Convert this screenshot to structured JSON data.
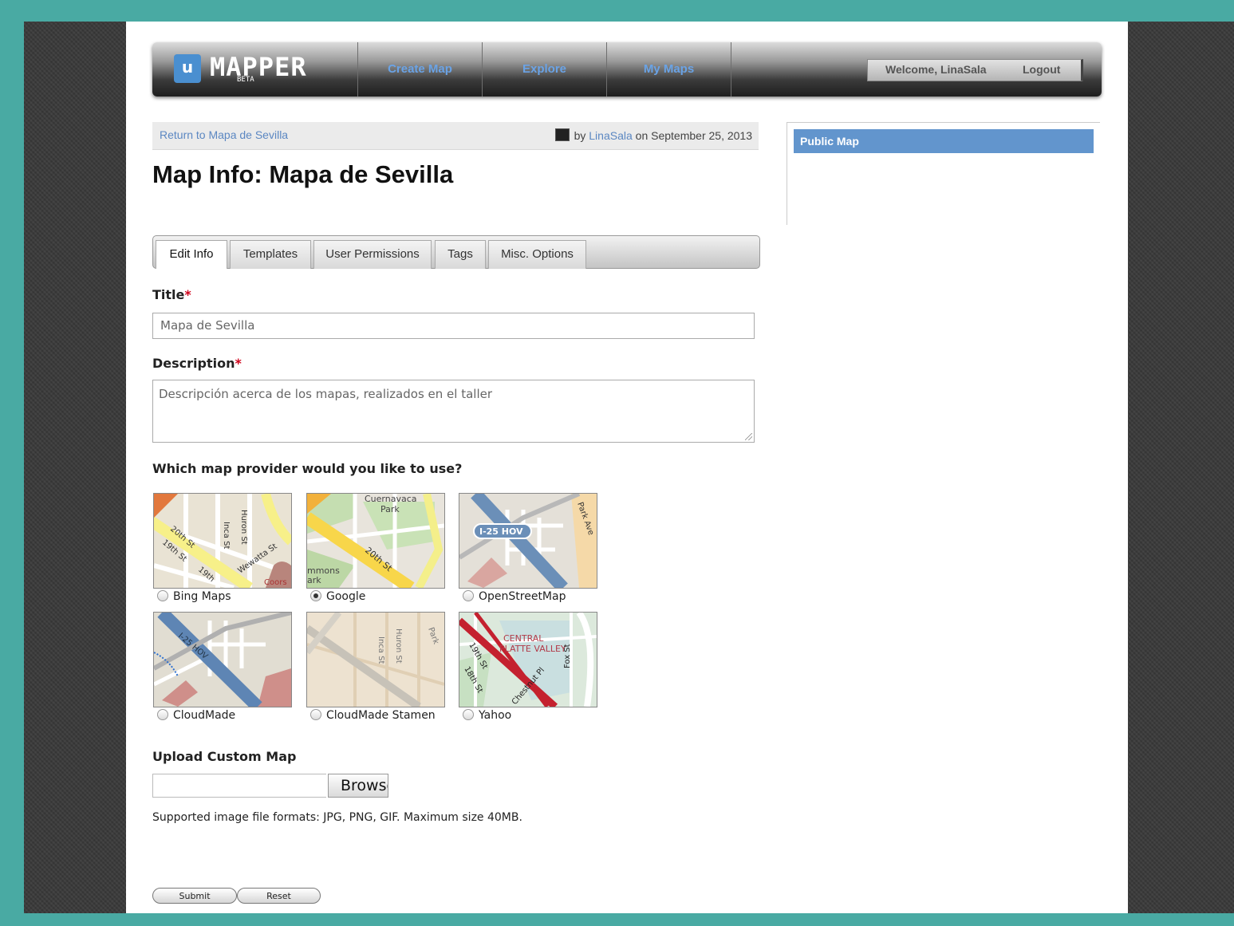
{
  "header": {
    "logo_letter": "u",
    "logo_name": "MAPPER",
    "logo_badge": "BETA",
    "nav": [
      "Create Map",
      "Explore",
      "My Maps"
    ],
    "welcome": "Welcome, LinaSala",
    "logout": "Logout"
  },
  "infobar": {
    "back_link": "Return to Mapa de Sevilla",
    "by": "by",
    "author": "LinaSala",
    "date": "on September 25, 2013"
  },
  "page_title": "Map Info: Mapa de Sevilla",
  "sidebar": {
    "heading": "Public Map"
  },
  "tabs": [
    {
      "label": "Edit Info"
    },
    {
      "label": "Templates"
    },
    {
      "label": "User Permissions"
    },
    {
      "label": "Tags"
    },
    {
      "label": "Misc. Options"
    }
  ],
  "form": {
    "title_label": "Title",
    "title_value": "Mapa de Sevilla",
    "description_label": "Description",
    "description_value": "Descripción acerca de los mapas, realizados en el taller",
    "required_marker": "*",
    "provider_question": "Which map provider would you like to use?",
    "providers": [
      {
        "label": "Bing Maps",
        "selected": false
      },
      {
        "label": "Google",
        "selected": true
      },
      {
        "label": "OpenStreetMap",
        "selected": false
      },
      {
        "label": "CloudMade",
        "selected": false
      },
      {
        "label": "CloudMade Stamen",
        "selected": false
      },
      {
        "label": "Yahoo",
        "selected": false
      }
    ],
    "thumb_text": {
      "bing": [
        "20th St",
        "19th St",
        "Inca St",
        "Huron St",
        "Wewatta St",
        "19th",
        "Coors"
      ],
      "google": [
        "Cuernavaca",
        "Park",
        "20th St",
        "mmons",
        "ark"
      ],
      "osm": [
        "I-25 HOV",
        "Park Ave"
      ],
      "cloudmade": [
        "I-25 HOV"
      ],
      "stamen": [
        "Inca St",
        "Huron St",
        "Park"
      ],
      "yahoo": [
        "CENTRAL",
        "PLATTE VALLEY",
        "19th St",
        "18th St",
        "Chestnut Pl",
        "Fox St"
      ]
    },
    "upload_label": "Upload Custom Map",
    "browse": "Browse",
    "formats": "Supported image file formats: JPG, PNG, GIF. Maximum size 40MB.",
    "submit": "Submit",
    "reset": "Reset"
  },
  "colors": {
    "page_border": "#49aaa3",
    "link": "#5b87c2",
    "nav_link": "#6aa3e6",
    "sidebar_head": "#6295cd",
    "required": "#d0021b"
  }
}
